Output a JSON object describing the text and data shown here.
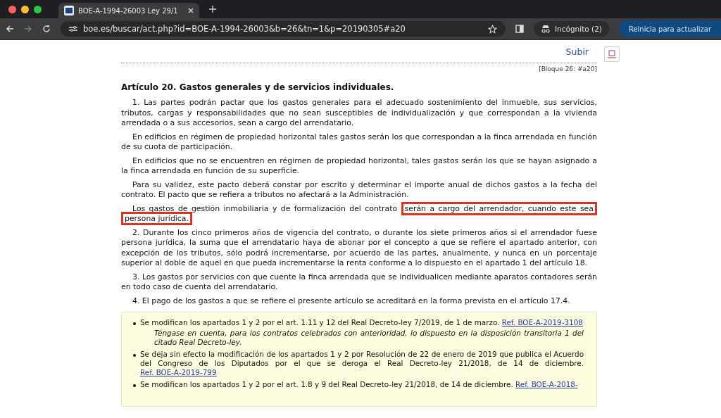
{
  "browser": {
    "tab": {
      "title": "BOE-A-1994-26003 Ley 29/1",
      "selected": true
    },
    "address": "boe.es/buscar/act.php?id=BOE-A-1994-26003&b=26&tn=1&p=20190305#a20",
    "profile": "Incógnito (2)",
    "update_button": "Reinicia para actualizar"
  },
  "page": {
    "top_link": "Subir",
    "block_ref": "[Bloque 26: #a20]",
    "heading": "Artículo 20. Gastos generales y de servicios individuales.",
    "paragraphs": [
      {
        "parts": [
          {
            "kind": "text",
            "text": "1. Las partes podrán pactar que los gastos generales para el adecuado sostenimiento del inmueble, sus servicios, tributos, cargas y responsabilidades que no sean susceptibles de individualización y que correspondan a la vivienda arrendada o a sus accesorios, sean a cargo del arrendatario."
          }
        ]
      },
      {
        "parts": [
          {
            "kind": "text",
            "text": "En edificios en régimen de propiedad horizontal tales gastos serán los que correspondan a la finca arrendada en función de su cuota de participación."
          }
        ]
      },
      {
        "parts": [
          {
            "kind": "text",
            "text": "En edificios que no se encuentren en régimen de propiedad horizontal, tales gastos serán los que se hayan asignado a la finca arrendada en función de su superficie."
          }
        ]
      },
      {
        "parts": [
          {
            "kind": "text",
            "text": "Para su validez, este pacto deberá constar por escrito y determinar el importe anual de dichos gastos a la fecha del contrato. El pacto que se refiera a tributos no afectará a la Administración."
          }
        ]
      },
      {
        "parts": [
          {
            "kind": "text",
            "text": "Los gastos de gestión inmobiliaria y de formalización del contrato"
          },
          {
            "kind": "highlight",
            "text": "serán a cargo del arrendador, cuando este sea"
          },
          {
            "kind": "highlight",
            "text": "persona jurídica."
          }
        ]
      },
      {
        "parts": [
          {
            "kind": "text",
            "text": "2. Durante los cinco primeros años de vigencia del contrato, o durante los siete primeros años si el arrendador fuese persona jurídica, la suma que el arrendatario haya de abonar por el concepto a que se refiere el apartado anterior, con excepción de los tributos, sólo podrá incrementarse, por acuerdo de las partes, anualmente, y nunca en un porcentaje superior al doble de aquel en que pueda incrementarse la renta conforme a lo dispuesto en el apartado 1 del artículo 18."
          }
        ]
      },
      {
        "parts": [
          {
            "kind": "text",
            "text": "3. Los gastos por servicios con que cuente la finca arrendada que se individualicen mediante aparatos contadores serán en todo caso de cuenta del arrendatario."
          }
        ]
      },
      {
        "parts": [
          {
            "kind": "text",
            "text": "4. El pago de los gastos a que se refiere el presente artículo se acreditará en la forma prevista en el artículo 17.4."
          }
        ]
      }
    ],
    "notes": [
      {
        "text": "Se modifican los apartados 1 y 2 por el art. 1.11 y 12 del Real Decreto-ley 7/2019, de 1 de marzo.",
        "link": "Ref. BOE-A-2019-3108",
        "remark": "Téngase en cuenta, para los contratos celebrados con anterioridad, lo dispuesto en la disposición transitoria 1 del citado Real Decreto-ley."
      },
      {
        "text": "Se deja sin efecto la modificación de los apartados 1 y 2 por Resolución de 22 de enero de 2019 que publica el Acuerdo del Congreso de los Diputados por el que se deroga el Real Decreto-ley 21/2018, de 14 de diciembre.",
        "link": "Ref. BOE-A-2019-799"
      },
      {
        "text": "Se modifican los apartados 1 y 2 por el art. 1.8 y 9 del Real Decreto-ley 21/2018, de 14 de diciembre.",
        "link": "Ref. BOE-A-2018-"
      }
    ]
  }
}
